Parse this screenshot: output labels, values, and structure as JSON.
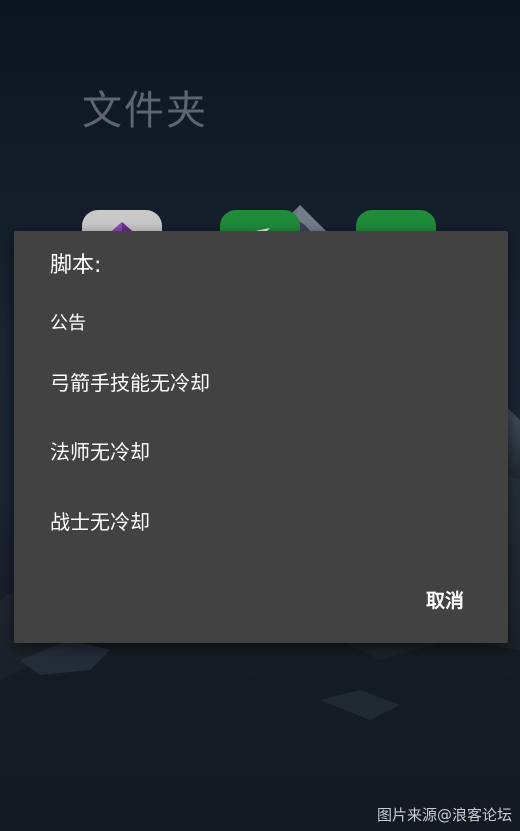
{
  "background": {
    "folder_title": "文件夹"
  },
  "dialog": {
    "title": "脚本:",
    "items": [
      {
        "label": "公告"
      },
      {
        "label": "弓箭手技能无冷却"
      },
      {
        "label": "法师无冷却"
      },
      {
        "label": "战士无冷却"
      }
    ],
    "cancel_label": "取消"
  },
  "watermark": "图片来源@浪客论坛",
  "colors": {
    "dialog_bg": "#424242",
    "text": "#ffffff",
    "app_green": "#1f8a3a",
    "app_gray": "#c9c9c9"
  },
  "icons": [
    "app-icon-purple-logo",
    "app-icon-green-arrow",
    "app-icon-green"
  ]
}
